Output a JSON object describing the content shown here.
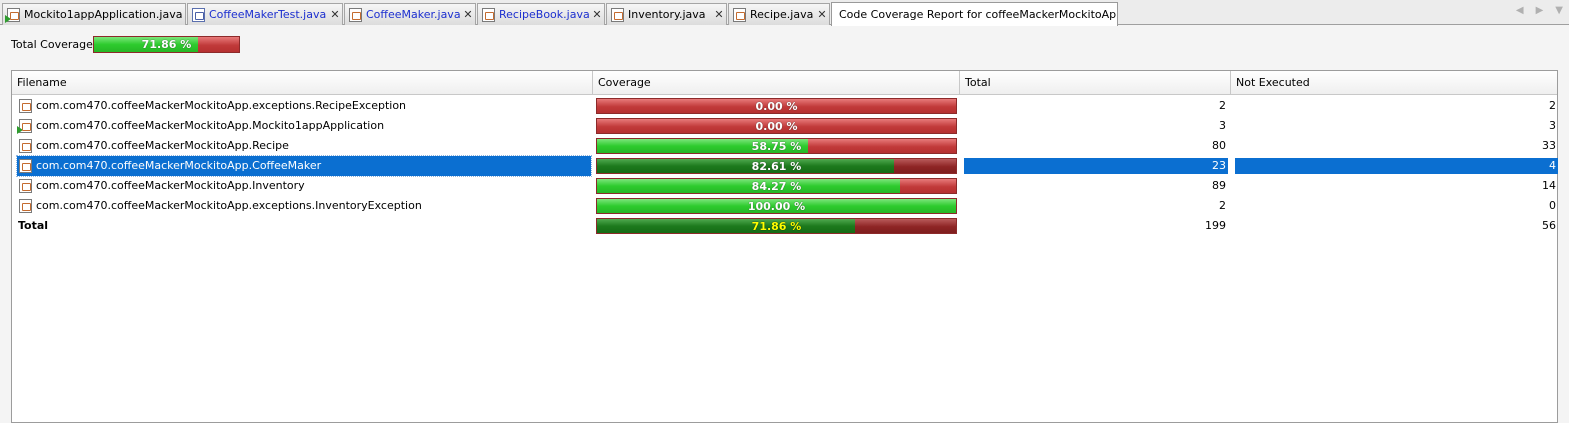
{
  "tabs": [
    {
      "label": "Mockito1appApplication.java",
      "icon": "java-run-file-icon",
      "color": "#000000"
    },
    {
      "label": "CoffeeMakerTest.java",
      "icon": "java-test-file-icon",
      "color": "#1c2fcf"
    },
    {
      "label": "CoffeeMaker.java",
      "icon": "java-file-icon",
      "color": "#1c2fcf"
    },
    {
      "label": "RecipeBook.java",
      "icon": "java-file-icon",
      "color": "#1c2fcf"
    },
    {
      "label": "Inventory.java",
      "icon": "java-file-icon",
      "color": "#000000"
    },
    {
      "label": "Recipe.java",
      "icon": "java-file-icon",
      "color": "#000000"
    },
    {
      "label": "Code Coverage Report for coffeeMackerMockitoApp",
      "icon": "",
      "color": "#000000"
    }
  ],
  "total_coverage": {
    "label": "Total Coverage:",
    "percent_text": "71.86 %",
    "fraction": 0.7186
  },
  "table": {
    "columns": [
      "Filename",
      "Coverage",
      "Total",
      "Not Executed"
    ],
    "rows": [
      {
        "filename": "com.com470.coffeeMackerMockitoApp.exceptions.RecipeException",
        "coverage_text": "0.00 %",
        "coverage": 0.0,
        "total": "2",
        "not_executed": "2",
        "selected": false
      },
      {
        "filename": "com.com470.coffeeMackerMockitoApp.Mockito1appApplication",
        "coverage_text": "0.00 %",
        "coverage": 0.0,
        "total": "3",
        "not_executed": "3",
        "selected": false
      },
      {
        "filename": "com.com470.coffeeMackerMockitoApp.Recipe",
        "coverage_text": "58.75 %",
        "coverage": 0.5875,
        "total": "80",
        "not_executed": "33",
        "selected": false
      },
      {
        "filename": "com.com470.coffeeMackerMockitoApp.CoffeeMaker",
        "coverage_text": "82.61 %",
        "coverage": 0.8261,
        "total": "23",
        "not_executed": "4",
        "selected": true
      },
      {
        "filename": "com.com470.coffeeMackerMockitoApp.Inventory",
        "coverage_text": "84.27 %",
        "coverage": 0.8427,
        "total": "89",
        "not_executed": "14",
        "selected": false
      },
      {
        "filename": "com.com470.coffeeMackerMockitoApp.exceptions.InventoryException",
        "coverage_text": "100.00 %",
        "coverage": 1.0,
        "total": "2",
        "not_executed": "0",
        "selected": false
      }
    ],
    "total_row": {
      "label": "Total",
      "coverage_text": "71.86 %",
      "coverage": 0.7186,
      "total": "199",
      "not_executed": "56"
    }
  },
  "colors": {
    "covered": "#2ecb2e",
    "uncovered": "#c13a3a",
    "selection": "#0b6fd1",
    "total_percent_text": "#ffff00"
  }
}
